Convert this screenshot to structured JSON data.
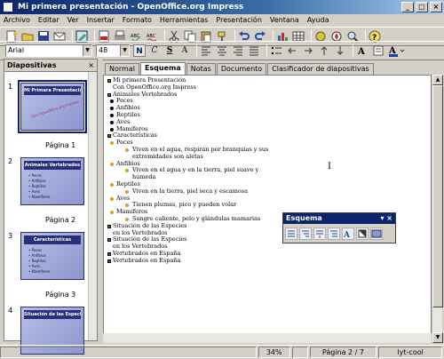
{
  "window": {
    "title": "Mi primera presentación - OpenOffice.org Impress"
  },
  "menu": [
    "Archivo",
    "Editar",
    "Ver",
    "Insertar",
    "Formato",
    "Herramientas",
    "Presentación",
    "Ventana",
    "Ayuda"
  ],
  "format_bar": {
    "font_name": "Arial",
    "font_size": "48"
  },
  "slides_panel": {
    "title": "Diapositivas",
    "slides": [
      {
        "num": "1",
        "page": "Página 1",
        "heading": "Mi Primera Presentación",
        "sub": "Con OpenOffice.org Impress",
        "lines": []
      },
      {
        "num": "2",
        "page": "Página 2",
        "heading": "Animales Vertebrados",
        "sub": "",
        "lines": [
          "• Peces",
          "• Anfibios",
          "• Reptiles",
          "• Aves",
          "• Mamíferos"
        ]
      },
      {
        "num": "3",
        "page": "Página 3",
        "heading": "Características",
        "sub": "",
        "lines": [
          "• Peces",
          "• Anfibios",
          "• Reptiles",
          "• Aves",
          "• Mamíferos"
        ]
      },
      {
        "num": "4",
        "page": "",
        "heading": "Situación de las Especies en los Vertebrados",
        "sub": "",
        "lines": []
      }
    ]
  },
  "tabs": [
    "Normal",
    "Esquema",
    "Notas",
    "Documento",
    "Clasificador de diapositivas"
  ],
  "outline": [
    {
      "level": 0,
      "marker": "sq",
      "text": "Mi primera  Presentación"
    },
    {
      "level": 0,
      "marker": "",
      "text": "Con OpenOffice.org Impress"
    },
    {
      "level": 0,
      "marker": "sq",
      "text": "Animales Vertebrados"
    },
    {
      "level": 1,
      "marker": "dot",
      "text": "Peces"
    },
    {
      "level": 1,
      "marker": "dot",
      "text": "Anfibios"
    },
    {
      "level": 1,
      "marker": "dot",
      "text": "Reptiles"
    },
    {
      "level": 1,
      "marker": "dot",
      "text": "Aves"
    },
    {
      "level": 1,
      "marker": "dot",
      "text": "Mamíferos"
    },
    {
      "level": 0,
      "marker": "sq",
      "text": "Características"
    },
    {
      "level": 1,
      "marker": "amb",
      "text": "Peces"
    },
    {
      "level": 3,
      "marker": "amb",
      "text": "Viven en el agua, respiran por branquias y sus"
    },
    {
      "level": 3,
      "marker": "",
      "text": "extremidades son aletas"
    },
    {
      "level": 1,
      "marker": "amb",
      "text": "Anfibios"
    },
    {
      "level": 3,
      "marker": "amb",
      "text": "Viven en el agua y en la tierra, piel suave y"
    },
    {
      "level": 3,
      "marker": "",
      "text": "húmeda"
    },
    {
      "level": 1,
      "marker": "amb",
      "text": "Reptiles"
    },
    {
      "level": 3,
      "marker": "amb",
      "text": "Viven en la tierra, piel seca y escamosa"
    },
    {
      "level": 1,
      "marker": "amb",
      "text": "Aves"
    },
    {
      "level": 3,
      "marker": "amb",
      "text": "Tienen plumas, pico y pueden volar"
    },
    {
      "level": 1,
      "marker": "amb",
      "text": "Mamíferos"
    },
    {
      "level": 3,
      "marker": "amb",
      "text": "Sangre caliente, pelo y glándulas mamarias"
    },
    {
      "level": 0,
      "marker": "sq",
      "text": "Situación de las Especies"
    },
    {
      "level": 0,
      "marker": "",
      "text": "en los Vertebrados"
    },
    {
      "level": 0,
      "marker": "sq",
      "text": "Situación de las Especies"
    },
    {
      "level": 0,
      "marker": "",
      "text": "en los Vertebrados"
    },
    {
      "level": 0,
      "marker": "sq",
      "text": "Vertebrados en España"
    },
    {
      "level": 0,
      "marker": "sq",
      "text": "Vertebrados en España"
    }
  ],
  "outline_toolbar": {
    "title": "Esquema"
  },
  "status": {
    "zoom": "34%",
    "page": "Página 2 / 7",
    "layout": "lyt-cool"
  }
}
